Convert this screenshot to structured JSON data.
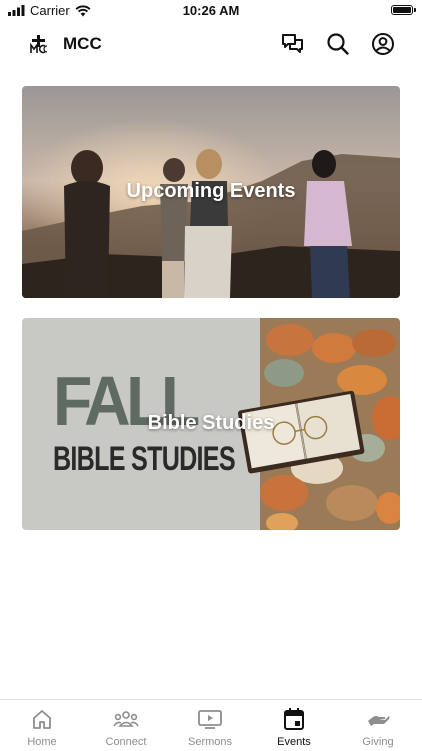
{
  "status_bar": {
    "carrier": "Carrier",
    "time": "10:26 AM",
    "battery_level": 1.0
  },
  "header": {
    "title": "MCC"
  },
  "cards": [
    {
      "title": "Upcoming Events"
    },
    {
      "title": "Bible Studies",
      "image_text_line1": "FALL",
      "image_text_line2": "BIBLE STUDIES"
    }
  ],
  "tabs": [
    {
      "label": "Home",
      "icon": "home-icon"
    },
    {
      "label": "Connect",
      "icon": "people-icon"
    },
    {
      "label": "Sermons",
      "icon": "play-icon"
    },
    {
      "label": "Events",
      "icon": "calendar-icon"
    },
    {
      "label": "Giving",
      "icon": "giving-hand-icon"
    }
  ],
  "colors": {
    "active_tab": "#111111",
    "inactive_tab": "#8e8e8e",
    "fall_text": "#5f6b62",
    "bible_text": "#2a2a2a"
  }
}
